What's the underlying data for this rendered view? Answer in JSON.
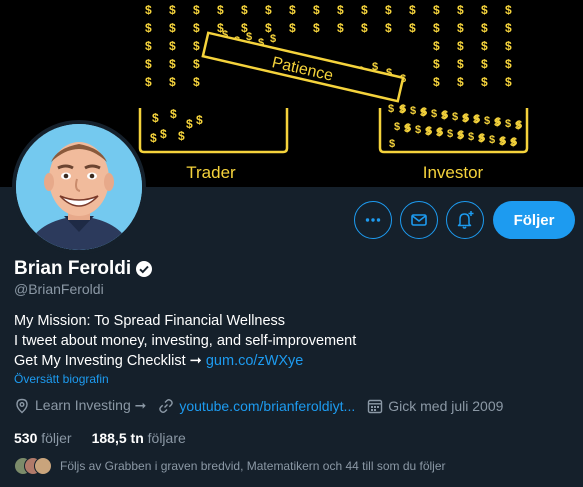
{
  "banner": {
    "left_label": "Trader",
    "right_label": "Investor",
    "center_label": "Patience",
    "dollar_glyph": "$"
  },
  "actions": {
    "more_icon": "more-icon",
    "message_icon": "mail-icon",
    "notify_icon": "bell-plus-icon",
    "follow_label": "Följer"
  },
  "profile": {
    "name": "Brian Feroldi",
    "handle": "@BrianFeroldi",
    "bio_lines": [
      "My Mission: To Spread Financial Wellness",
      "I tweet about money, investing, and self-improvement",
      "Get My Investing Checklist ➞ "
    ],
    "bio_link": "gum.co/zWXye",
    "translate_label": "Översätt biografin",
    "location": "Learn Investing ➞",
    "website": "youtube.com/brianferoldiyt...",
    "joined": "Gick med juli 2009"
  },
  "stats": {
    "following_count": "530",
    "following_label": "följer",
    "followers_count": "188,5 tn",
    "followers_label": "följare"
  },
  "followed_by": "Följs av Grabben i graven bredvid, Matematikern och 44 till som du följer",
  "colors": {
    "background": "#15202b",
    "accent": "#1d9bf0",
    "banner_gold": "#f5d33c",
    "muted": "#8b98a5"
  }
}
